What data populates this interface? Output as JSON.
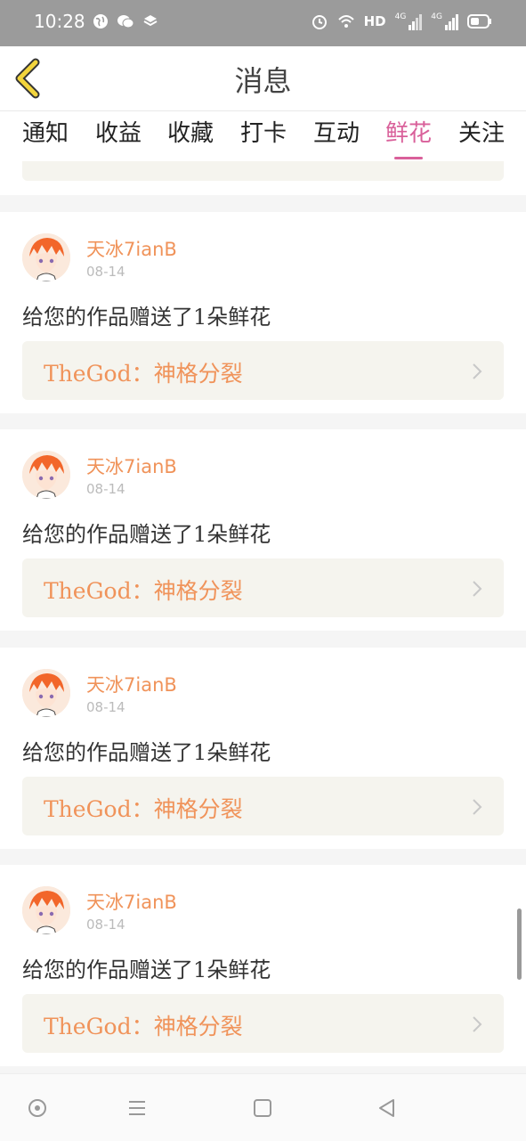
{
  "status_bar": {
    "time": "10:28",
    "hd_label": "HD",
    "signal_1_label": "4G",
    "signal_2_label": "4G",
    "icons": [
      "globe-icon",
      "wechat-icon",
      "layers-icon",
      "alarm-icon",
      "wifi-icon",
      "signal-icon",
      "signal-icon",
      "battery-icon"
    ]
  },
  "header": {
    "title": "消息",
    "back_icon": "chevron-left-icon"
  },
  "tabs": [
    {
      "label": "通知",
      "active": false
    },
    {
      "label": "收益",
      "active": false
    },
    {
      "label": "收藏",
      "active": false
    },
    {
      "label": "打卡",
      "active": false
    },
    {
      "label": "互动",
      "active": false
    },
    {
      "label": "鲜花",
      "active": true
    },
    {
      "label": "关注",
      "active": false
    }
  ],
  "cards": [
    {
      "username": "天冰7ianB",
      "date": "08-14",
      "message": "给您的作品赠送了1朵鲜花",
      "work_title": "TheGod：神格分裂"
    },
    {
      "username": "天冰7ianB",
      "date": "08-14",
      "message": "给您的作品赠送了1朵鲜花",
      "work_title": "TheGod：神格分裂"
    },
    {
      "username": "天冰7ianB",
      "date": "08-14",
      "message": "给您的作品赠送了1朵鲜花",
      "work_title": "TheGod：神格分裂"
    },
    {
      "username": "天冰7ianB",
      "date": "08-14",
      "message": "给您的作品赠送了1朵鲜花",
      "work_title": "TheGod：神格分裂"
    }
  ],
  "colors": {
    "accent": "#d9609a",
    "username": "#f0935a",
    "back_arrow": "#f2d43c",
    "status_bar": "#9b9b9b"
  },
  "nav_bar": {
    "icons": [
      "circle-icon",
      "menu-icon",
      "square-icon",
      "back-triangle-icon"
    ]
  }
}
